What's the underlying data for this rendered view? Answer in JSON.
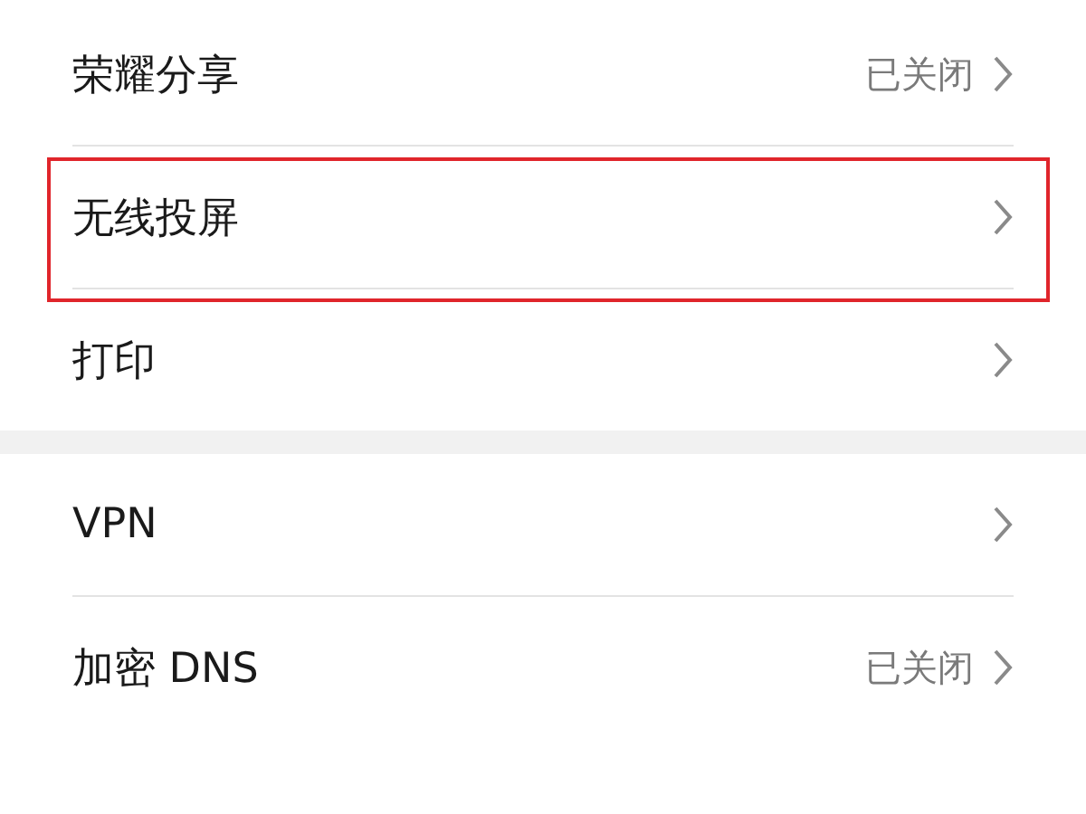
{
  "groups": [
    {
      "items": [
        {
          "label": "荣耀分享",
          "value": "已关闭",
          "highlighted": false
        },
        {
          "label": "无线投屏",
          "highlighted": true
        },
        {
          "label": "打印",
          "highlighted": false
        }
      ]
    },
    {
      "items": [
        {
          "label": "VPN",
          "highlighted": false
        },
        {
          "label": "加密 DNS",
          "value": "已关闭",
          "highlighted": false
        }
      ]
    }
  ]
}
